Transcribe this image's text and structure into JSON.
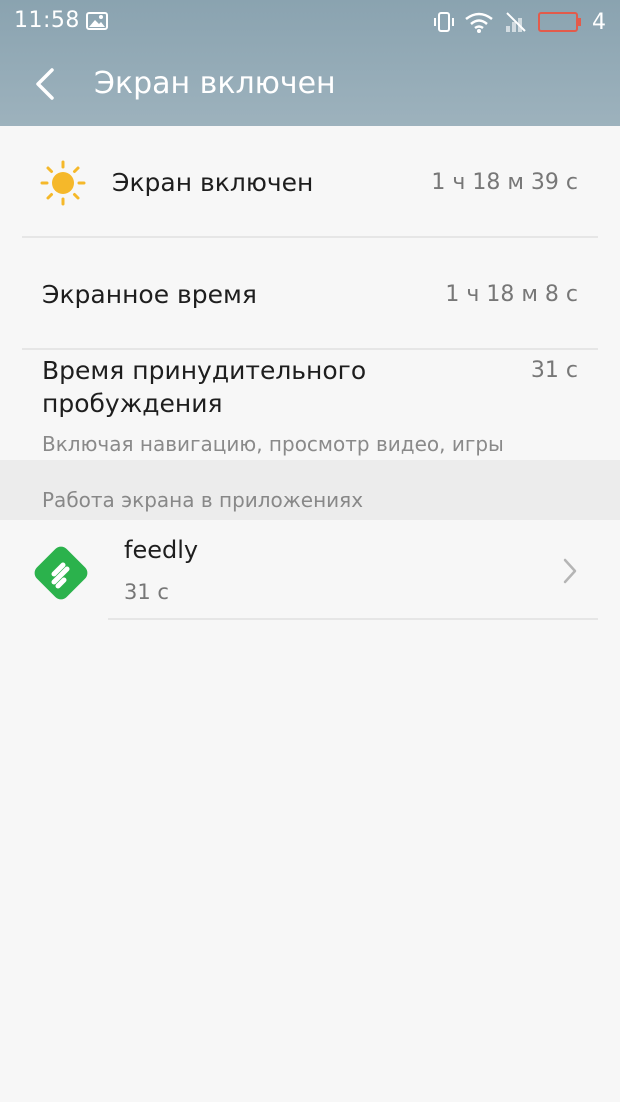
{
  "status_bar": {
    "time": "11:58",
    "battery_level": "4"
  },
  "app_bar": {
    "back_icon": "chevron-left-icon",
    "title": "Экран включен"
  },
  "rows": [
    {
      "icon": "sun-icon",
      "label": "Экран включен",
      "value": "1 ч 18 м 39 с"
    },
    {
      "label": "Экранное время",
      "value": "1 ч 18 м 8 с"
    },
    {
      "label_line1": "Время принудительного",
      "label_line2": "пробуждения",
      "value": "31 с",
      "subtext": "Включая навигацию, просмотр видео, игры"
    }
  ],
  "section": {
    "title": "Работа экрана в приложениях"
  },
  "apps": [
    {
      "icon": "feedly-icon",
      "name": "feedly",
      "time": "31 с"
    }
  ],
  "colors": {
    "header": "#9db2bd",
    "background": "#f7f7f7",
    "sun": "#f5b82a",
    "feedly": "#2bb24c"
  }
}
